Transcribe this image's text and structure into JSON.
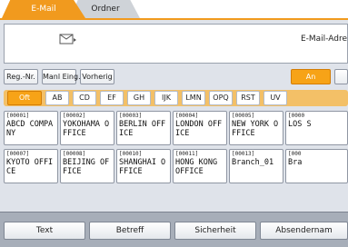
{
  "tabs": {
    "email": "E-Mail",
    "ordner": "Ordner"
  },
  "destination": {
    "email_label": "E-Mail-Adre"
  },
  "toolbar": {
    "reg_nr": "Reg.-Nr.",
    "manual": "Manl Eing.",
    "previous": "Vorherig",
    "add": "An"
  },
  "alphabet": [
    "Oft",
    "AB",
    "CD",
    "EF",
    "GH",
    "IJK",
    "LMN",
    "OPQ",
    "RST",
    "UV"
  ],
  "entries": [
    {
      "num": "[00001]",
      "name": "ABCD COMPANY"
    },
    {
      "num": "[00002]",
      "name": "YOKOHAMA OFFICE"
    },
    {
      "num": "[00003]",
      "name": "BERLIN OFFICE"
    },
    {
      "num": "[00004]",
      "name": "LONDON OFFICE"
    },
    {
      "num": "[00005]",
      "name": "NEW YORK OFFICE"
    },
    {
      "num": "[0000",
      "name": "LOS S"
    },
    {
      "num": "[00007]",
      "name": "KYOTO OFFICE"
    },
    {
      "num": "[00008]",
      "name": "BEIJING OFFICE"
    },
    {
      "num": "[00010]",
      "name": "SHANGHAI OFFICE"
    },
    {
      "num": "[00011]",
      "name": "HONG KONG OFFICE"
    },
    {
      "num": "[00013]",
      "name": "Branch_01"
    },
    {
      "num": "[000",
      "name": "Bra"
    }
  ],
  "bottom": {
    "text": "Text",
    "subject": "Betreff",
    "security": "Sicherheit",
    "sender": "Absendernam"
  }
}
